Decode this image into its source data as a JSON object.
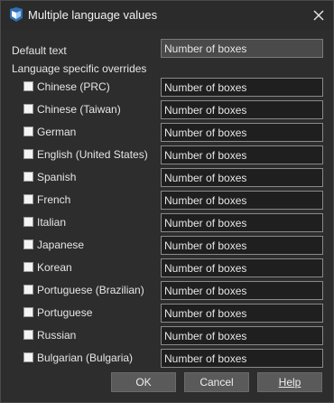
{
  "window": {
    "title": "Multiple language values",
    "icon": "app-logo-icon",
    "close_icon": "close-icon"
  },
  "default_text": {
    "label": "Default text",
    "value": "Number of boxes"
  },
  "overrides_heading": "Language specific overrides",
  "languages": [
    {
      "label": "Chinese (PRC)",
      "value": "Number of boxes",
      "checked": false
    },
    {
      "label": "Chinese (Taiwan)",
      "value": "Number of boxes",
      "checked": false
    },
    {
      "label": "German",
      "value": "Number of boxes",
      "checked": false
    },
    {
      "label": "English (United States)",
      "value": "Number of boxes",
      "checked": false
    },
    {
      "label": "Spanish",
      "value": "Number of boxes",
      "checked": false
    },
    {
      "label": "French",
      "value": "Number of boxes",
      "checked": false
    },
    {
      "label": "Italian",
      "value": "Number of boxes",
      "checked": false
    },
    {
      "label": "Japanese",
      "value": "Number of boxes",
      "checked": false
    },
    {
      "label": "Korean",
      "value": "Number of boxes",
      "checked": false
    },
    {
      "label": "Portuguese (Brazilian)",
      "value": "Number of boxes",
      "checked": false
    },
    {
      "label": "Portuguese",
      "value": "Number of boxes",
      "checked": false
    },
    {
      "label": "Russian",
      "value": "Number of boxes",
      "checked": false
    },
    {
      "label": "Bulgarian (Bulgaria)",
      "value": "Number of boxes",
      "checked": false
    }
  ],
  "buttons": {
    "ok": "OK",
    "cancel": "Cancel",
    "help": "Help"
  }
}
